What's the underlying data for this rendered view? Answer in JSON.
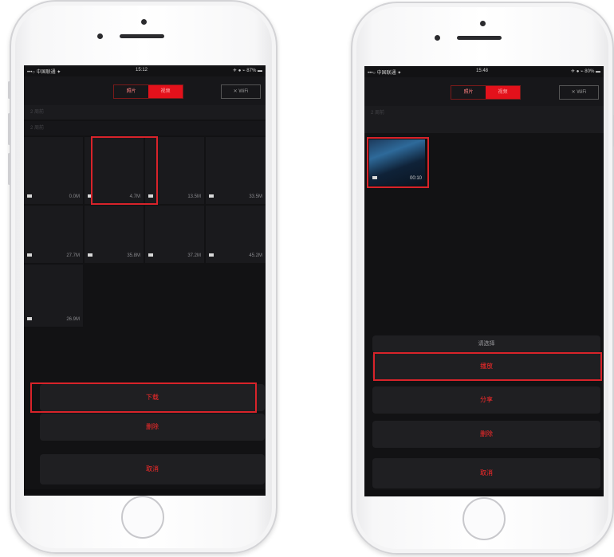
{
  "colors": {
    "accent": "#e3111b",
    "highlight": "#d8232a",
    "screen_bg": "#121214"
  },
  "left_phone": {
    "status": {
      "carrier": "•••○ 中国联通 ✦",
      "time": "15:12",
      "battery": "✈ ● ⌁ 87% ▬"
    },
    "nav": {
      "tab_left": "照片",
      "tab_right": "视频",
      "wifi_button": "✕ WiFi"
    },
    "section_labels": [
      "2 周前",
      "2 周前"
    ],
    "videos": [
      {
        "duration": "0.0M"
      },
      {
        "duration": "4.7M"
      },
      {
        "duration": "13.5M"
      },
      {
        "duration": "33.5M"
      },
      {
        "duration": "27.7M"
      },
      {
        "duration": "35.8M"
      },
      {
        "duration": "37.2M"
      },
      {
        "duration": "45.2M"
      },
      {
        "duration": "26.9M"
      }
    ],
    "sheet": {
      "primary": "下载",
      "secondary": "删除",
      "cancel": "取消"
    }
  },
  "right_phone": {
    "status": {
      "carrier": "•••○ 中国联通 ✦",
      "time": "15:48",
      "battery": "✈ ● ⌁ 80% ▬"
    },
    "nav": {
      "tab_left": "照片",
      "tab_right": "视频",
      "wifi_button": "✕ WiFi"
    },
    "section_label": "2 周前",
    "video": {
      "duration": "00:10"
    },
    "sheet": {
      "title": "请选择",
      "option1": "播放",
      "option2": "分享",
      "option3": "删除",
      "cancel": "取消"
    }
  }
}
